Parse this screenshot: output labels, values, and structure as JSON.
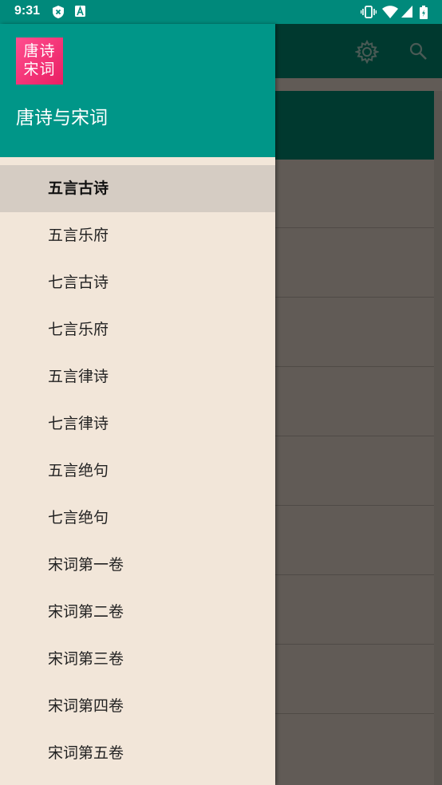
{
  "status_bar": {
    "time": "9:31",
    "left_icons": [
      "shield-x-icon",
      "font-a-icon"
    ],
    "right_icons": [
      "vibrate-icon",
      "wifi-icon",
      "signal-icon",
      "battery-icon"
    ]
  },
  "drawer": {
    "logo_line1": "唐诗",
    "logo_line2": "宋词",
    "title": "唐诗与宋词",
    "items": [
      {
        "label": "五言古诗",
        "active": true
      },
      {
        "label": "五言乐府"
      },
      {
        "label": "七言古诗"
      },
      {
        "label": "七言乐府"
      },
      {
        "label": "五言律诗"
      },
      {
        "label": "七言律诗"
      },
      {
        "label": "五言绝句"
      },
      {
        "label": "七言绝句"
      },
      {
        "label": "宋词第一卷"
      },
      {
        "label": "宋词第二卷"
      },
      {
        "label": "宋词第三卷"
      },
      {
        "label": "宋词第四卷"
      },
      {
        "label": "宋词第五卷"
      }
    ]
  },
  "toolbar": {
    "icons": [
      "settings-icon",
      "search-icon"
    ]
  },
  "colors": {
    "status_bar": "#00897b",
    "drawer_header": "#009688",
    "drawer_bg": "#f2e6d9",
    "active_item_bg": "#d5ccc3",
    "logo": "#e91e63",
    "toolbar_dark": "#00392f"
  }
}
